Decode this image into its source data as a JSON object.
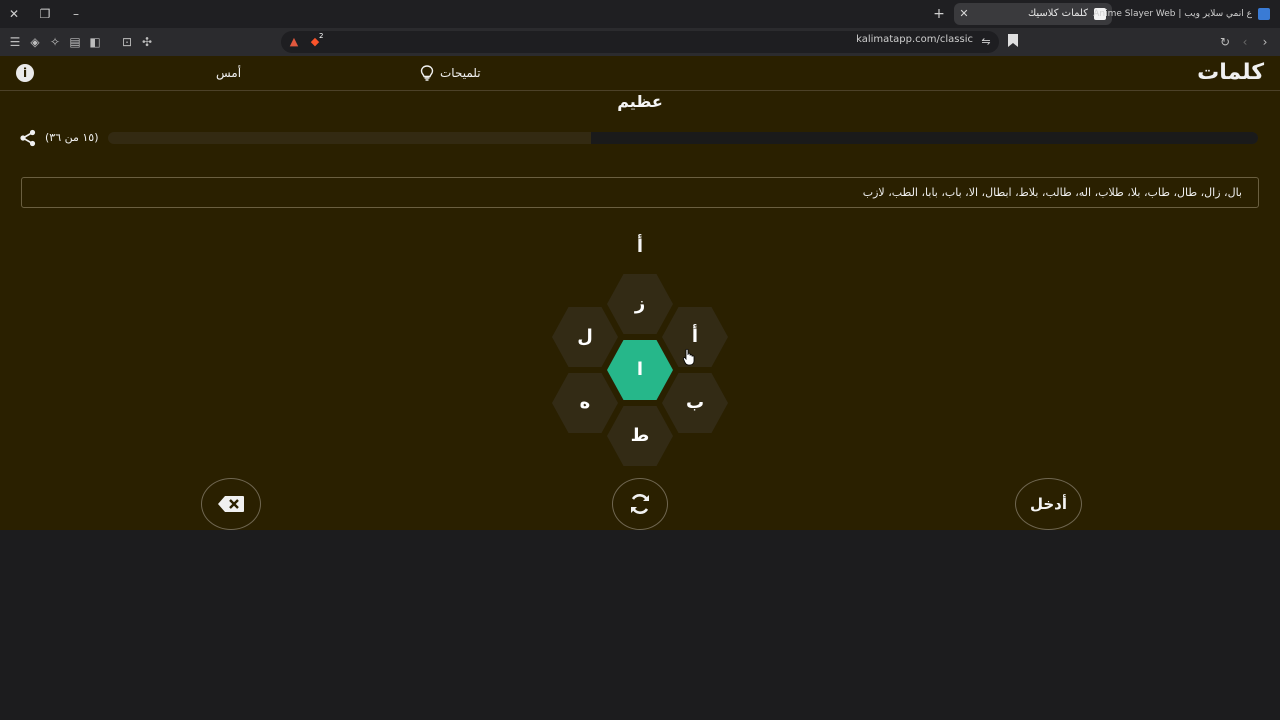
{
  "browser": {
    "tabs": [
      {
        "title": "كلمات كلاسيك",
        "active": true
      },
      {
        "title": "Anime Slayer Web | ع انمي سلاير ويب",
        "active": false
      }
    ],
    "address": "kalimatapp.com/classic",
    "shield_badge": "2"
  },
  "header": {
    "logo": "كلمات",
    "hints_label": "تلميحات",
    "yesterday_label": "أمس",
    "info_label": "i"
  },
  "game": {
    "rank": "عظيم",
    "count_label": "(١٥ من ٣٦)",
    "progress_fraction": 0.58,
    "found_words": "بال، زال، طال، طاب، بلا، طلاب، اله، طالب، بلاط، ابطال، الا، باب، بابا، الطب، لازب",
    "current_word": "أ",
    "letters": {
      "center": "ا",
      "top": "ز",
      "top_right": "أ",
      "top_left": "ل",
      "bottom_right": "ب",
      "bottom_left": "ه",
      "bottom": "ط"
    },
    "enter_label": "أدخل"
  },
  "colors": {
    "background": "#2a2000",
    "center_hex": "#26b78a",
    "outer_hex": "#332b15",
    "progress_track": "#1a1a1a"
  }
}
